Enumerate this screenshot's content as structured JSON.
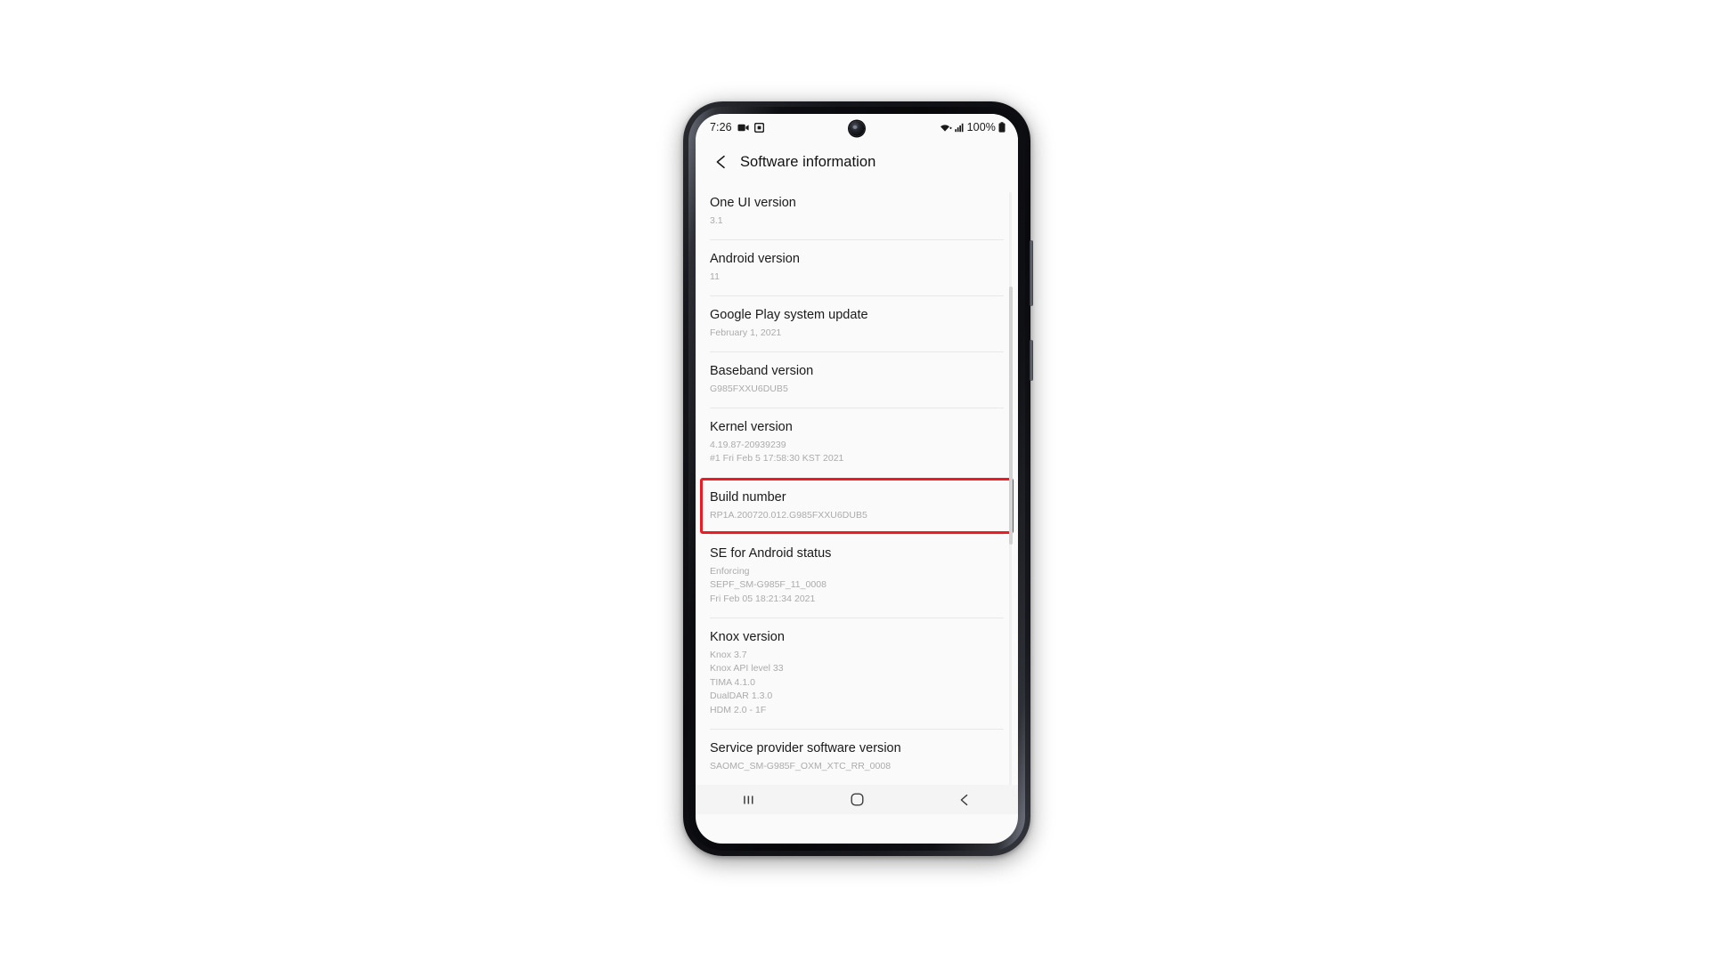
{
  "status_bar": {
    "clock": "7:26",
    "icons_left": [
      "video-camera-icon",
      "screen-recorder-icon"
    ],
    "icons_right": [
      "wifi-icon",
      "signal-bars-icon"
    ],
    "battery_percent": "100%",
    "battery_icon": "battery-full-icon"
  },
  "app_bar": {
    "back_icon": "chevron-left-icon",
    "title": "Software information"
  },
  "colors": {
    "highlight": "#ed1c24",
    "screen_bg": "#fafafa",
    "title_text": "#1a1a1a",
    "sub_text": "#ababab",
    "divider": "#e8e8e8"
  },
  "list": {
    "items": [
      {
        "name": "one-ui-version",
        "title": "One UI version",
        "sublines": [
          "3.1"
        ],
        "highlighted": false
      },
      {
        "name": "android-version",
        "title": "Android version",
        "sublines": [
          "11"
        ],
        "highlighted": false
      },
      {
        "name": "google-play-system-update",
        "title": "Google Play system update",
        "sublines": [
          "February 1, 2021"
        ],
        "highlighted": false
      },
      {
        "name": "baseband-version",
        "title": "Baseband version",
        "sublines": [
          "G985FXXU6DUB5"
        ],
        "highlighted": false
      },
      {
        "name": "kernel-version",
        "title": "Kernel version",
        "sublines": [
          "4.19.87-20939239",
          "#1 Fri Feb 5 17:58:30 KST 2021"
        ],
        "highlighted": false
      },
      {
        "name": "build-number",
        "title": "Build number",
        "sublines": [
          "RP1A.200720.012.G985FXXU6DUB5"
        ],
        "highlighted": true
      },
      {
        "name": "se-for-android-status",
        "title": "SE for Android status",
        "sublines": [
          "Enforcing",
          "SEPF_SM-G985F_11_0008",
          "Fri Feb 05 18:21:34 2021"
        ],
        "highlighted": false
      },
      {
        "name": "knox-version",
        "title": "Knox version",
        "sublines": [
          "Knox 3.7",
          "Knox API level 33",
          "TIMA 4.1.0",
          "DualDAR 1.3.0",
          "HDM 2.0 - 1F"
        ],
        "highlighted": false
      },
      {
        "name": "service-provider-software-version",
        "title": "Service provider software version",
        "sublines": [
          "SAOMC_SM-G985F_OXM_XTC_RR_0008"
        ],
        "highlighted": false
      }
    ]
  },
  "nav_bar": {
    "recents_icon": "recents-icon",
    "home_icon": "home-icon",
    "back_icon": "back-icon"
  }
}
